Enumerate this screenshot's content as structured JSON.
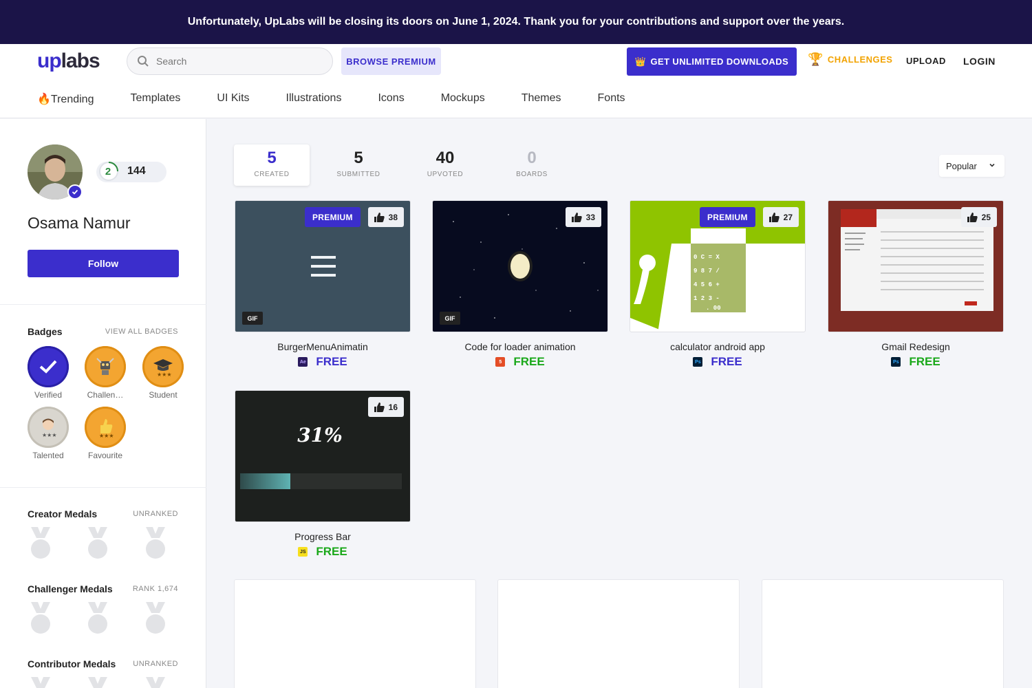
{
  "banner": {
    "text": "Unfortunately, UpLabs will be closing its doors on June 1, 2024. Thank you for your contributions and support over the years."
  },
  "header": {
    "logo_up": "up",
    "logo_labs": "labs",
    "search_placeholder": "Search",
    "browse_premium": "BROWSE PREMIUM",
    "get_unlimited": "GET UNLIMITED DOWNLOADS",
    "challenges": "CHALLENGES",
    "upload": "UPLOAD",
    "login": "LOGIN"
  },
  "categories": [
    "🔥Trending",
    "Templates",
    "UI Kits",
    "Illustrations",
    "Icons",
    "Mockups",
    "Themes",
    "Fonts"
  ],
  "profile": {
    "level": "2",
    "points": "144",
    "name": "Osama Namur",
    "follow": "Follow"
  },
  "badges_section": {
    "title": "Badges",
    "view_all": "VIEW ALL BADGES",
    "items": [
      {
        "label": "Verified",
        "icon": "check-icon"
      },
      {
        "label": "Challen…",
        "icon": "robot-icon"
      },
      {
        "label": "Student",
        "icon": "graduation-cap-icon"
      },
      {
        "label": "Talented",
        "icon": "person-icon"
      },
      {
        "label": "Favourite",
        "icon": "thumbs-up-icon"
      }
    ]
  },
  "medals": {
    "creator": {
      "title": "Creator Medals",
      "status": "UNRANKED"
    },
    "challenger": {
      "title": "Challenger Medals",
      "status": "RANK 1,674"
    },
    "contributor": {
      "title": "Contributor Medals",
      "status": "UNRANKED"
    }
  },
  "stats": [
    {
      "value": "5",
      "label": "CREATED"
    },
    {
      "value": "5",
      "label": "SUBMITTED"
    },
    {
      "value": "40",
      "label": "UPVOTED"
    },
    {
      "value": "0",
      "label": "BOARDS"
    }
  ],
  "sort": {
    "selected": "Popular"
  },
  "cards": [
    {
      "title": "BurgerMenuAnimatin",
      "likes": "38",
      "price": "FREE",
      "premium": "PREMIUM",
      "gif": "GIF",
      "tool": "Ae"
    },
    {
      "title": "Code for loader animation",
      "likes": "33",
      "price": "FREE",
      "gif": "GIF",
      "tool": "5"
    },
    {
      "title": "calculator android app",
      "likes": "27",
      "price": "FREE",
      "premium": "PREMIUM",
      "tool": "Ps"
    },
    {
      "title": "Gmail Redesign",
      "likes": "25",
      "price": "FREE",
      "tool": "Ps"
    },
    {
      "title": "Progress Bar",
      "likes": "16",
      "price": "FREE",
      "tool": "JS",
      "progress_text": "31%",
      "progress_value": 0.31
    }
  ],
  "colors": {
    "accent": "#3b2ecc",
    "banner": "#1b1448",
    "free_green": "#1aa81a",
    "free_blue": "#3b2ecc",
    "gold": "#f2a300"
  }
}
